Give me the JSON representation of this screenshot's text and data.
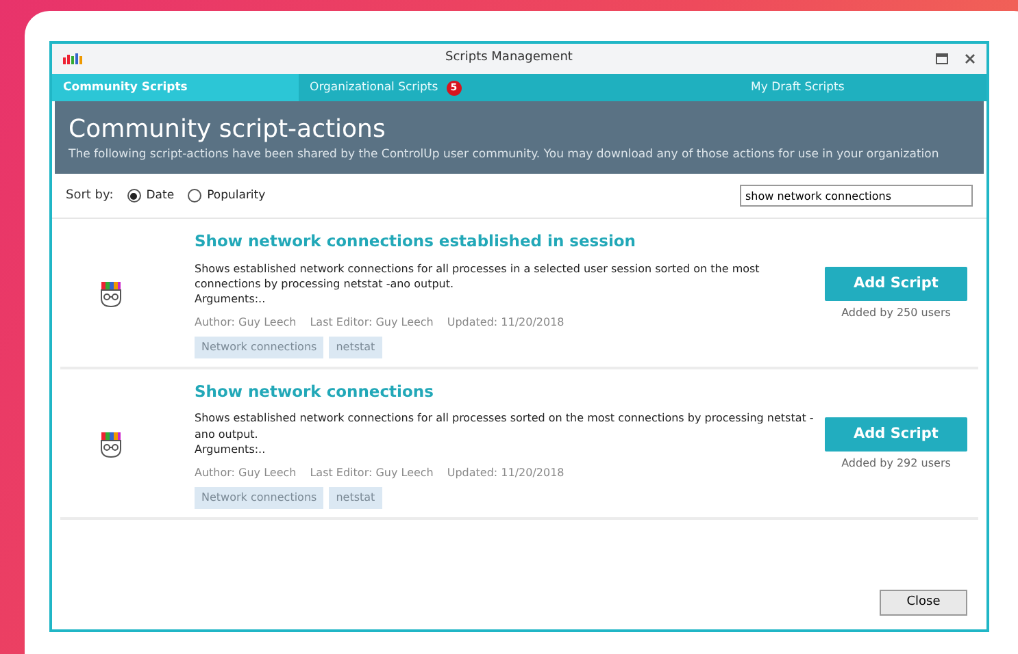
{
  "window": {
    "title": "Scripts Management"
  },
  "tabs": [
    {
      "label": "Community Scripts",
      "selected": true
    },
    {
      "label": "Organizational Scripts",
      "selected": false,
      "badge": "5"
    },
    {
      "label": "My Draft Scripts",
      "selected": false
    }
  ],
  "header": {
    "title": "Community script-actions",
    "description": "The following script-actions have been shared by the ControlUp user community. You may download any of those actions for use in your organization"
  },
  "sort": {
    "label": "Sort by:",
    "options": [
      {
        "label": "Date",
        "selected": true
      },
      {
        "label": "Popularity",
        "selected": false
      }
    ]
  },
  "search": {
    "value": "show network connections"
  },
  "scripts": [
    {
      "title": "Show network connections established in session",
      "description": "Shows established network connections for all processes in a selected user session sorted on the most connections by processing netstat -ano output.",
      "arguments": "Arguments:..",
      "author": "Author: Guy Leech",
      "editor": "Last Editor: Guy Leech",
      "updated": "Updated: 11/20/2018",
      "tags": [
        "Network connections",
        "netstat"
      ],
      "button": "Add Script",
      "added": "Added by 250 users"
    },
    {
      "title": "Show network connections",
      "description": "Shows established network connections for all processes sorted on the most connections by processing netstat -ano output.",
      "arguments": "Arguments:..",
      "author": "Author: Guy Leech",
      "editor": "Last Editor: Guy Leech",
      "updated": "Updated: 11/20/2018",
      "tags": [
        "Network connections",
        "netstat"
      ],
      "button": "Add Script",
      "added": "Added by 292 users"
    }
  ],
  "close_button": "Close"
}
